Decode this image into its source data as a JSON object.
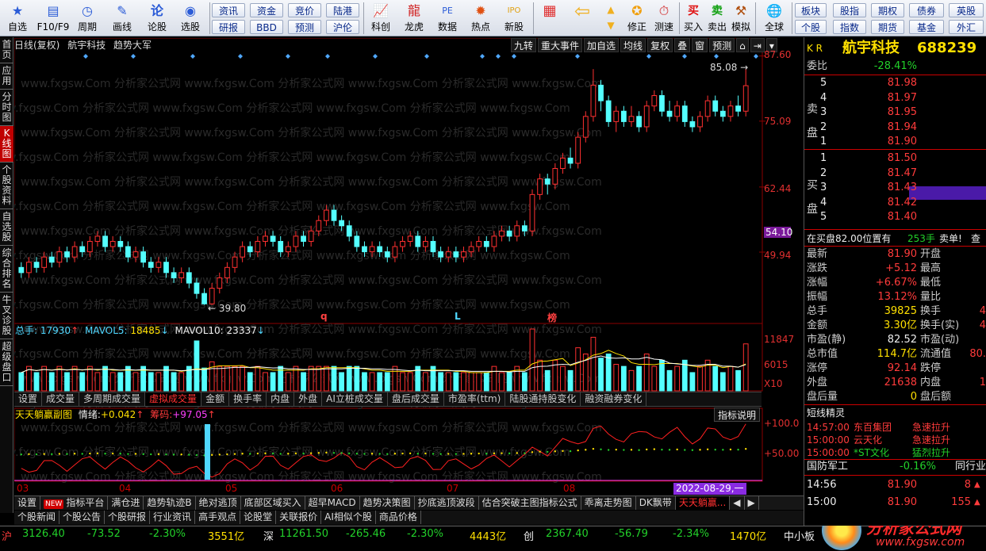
{
  "toolbar": {
    "big_buttons": [
      {
        "label": "自选",
        "icon": "star-icon"
      },
      {
        "label": "F10/F9",
        "icon": "document-icon"
      },
      {
        "label": "周期",
        "icon": "cycle-icon"
      },
      {
        "label": "画线",
        "icon": "pencil-icon"
      },
      {
        "label": "论股",
        "icon": "forum-icon"
      },
      {
        "label": "选股",
        "icon": "stock-picker-icon"
      }
    ],
    "small_buttons_top": [
      "资讯",
      "资金",
      "竞价",
      "陆港"
    ],
    "small_buttons_bottom": [
      "研报",
      "BBD",
      "预测",
      "沪伦"
    ],
    "mid_buttons": [
      {
        "label": "科创",
        "icon": "chart-icon"
      },
      {
        "label": "龙虎",
        "icon": "dragon-icon"
      },
      {
        "label": "数据",
        "icon": "data-icon"
      },
      {
        "label": "热点",
        "icon": "hot-icon"
      },
      {
        "label": "新股",
        "icon": "ipo-icon"
      }
    ],
    "right_buttons": [
      {
        "label": "",
        "icon": "blocks-icon"
      },
      {
        "label": "",
        "icon": "back-arrow-icon"
      },
      {
        "label": "修正",
        "icon": "fix-icon"
      },
      {
        "label": "测速",
        "icon": "speed-icon"
      },
      {
        "label": "买入",
        "icon": "buy-icon"
      },
      {
        "label": "卖出",
        "icon": "sell-icon"
      },
      {
        "label": "模拟",
        "icon": "hammer-icon"
      },
      {
        "label": "全球",
        "icon": "globe-icon"
      }
    ],
    "far_right_top": [
      "板块",
      "股指",
      "期权",
      "债券",
      "英股"
    ],
    "far_right_bottom": [
      "个股",
      "指数",
      "期货",
      "基金",
      "外汇"
    ]
  },
  "left_tabs": [
    "首页",
    "应用",
    "分时图",
    "K线图",
    "个股资料",
    "自选股",
    "综合排名",
    "牛叉诊股",
    "超级盘口"
  ],
  "chart": {
    "period_label": "日线(复权)",
    "stock_name": "航宇科技",
    "indicator_name": "趋势大军",
    "buttons": [
      "九转",
      "重大事件",
      "加自选",
      "均线",
      "复权",
      "叠",
      "窗",
      "预测"
    ],
    "price_ticks": [
      "87.60",
      "75.09",
      "62.44",
      "49.94"
    ],
    "current_price_tag": "54.10",
    "high_marker": "85.08",
    "low_marker": "39.80",
    "event_markers": [
      "q",
      "L",
      "榜"
    ],
    "colors": {
      "up": "#ff3030",
      "down": "#54ffff",
      "axis": "#8b0000"
    }
  },
  "volume": {
    "label": "总手",
    "value": "17930",
    "mavol5_label": "MAVOL5:",
    "mavol5": "18485",
    "mavol10_label": "MAVOL10:",
    "mavol10": "23337",
    "ticks": [
      "11847",
      "6015",
      "X10"
    ]
  },
  "indicator_tabs": [
    "设置",
    "成交量",
    "多周期成交量",
    "虚拟成交量",
    "金额",
    "换手率",
    "内盘",
    "外盘",
    "AI立桩成交量",
    "盘后成交量",
    "市盈率(ttm)",
    "陆股通持股变化",
    "融资融券变化"
  ],
  "sub_chart": {
    "title": "天天躺赢副图",
    "mood_label": "情绪:",
    "mood_value": "+0.042",
    "chip_label": "筹码:",
    "chip_value": "+97.05",
    "help_button": "指标说明",
    "ticks": [
      "+100.0",
      "+50.00"
    ]
  },
  "date_axis": {
    "labels": [
      "03",
      "04",
      "05",
      "06",
      "07",
      "08"
    ],
    "highlight": "2022-08-29,一"
  },
  "bottom_tabs": [
    "设置",
    "指标平台",
    "满仓进",
    "趋势轨迹B",
    "绝对逃顶",
    "底部区域买入",
    "超早MACD",
    "趋势决策图",
    "抄底逃顶波段",
    "估合突破主图指标公式",
    "乖离走势图",
    "DK飘带",
    "天天躺赢..."
  ],
  "bottom_new_badge": "NEW",
  "info_tabs": [
    "个股新闻",
    "个股公告",
    "个股研报",
    "行业资讯",
    "高手观点",
    "论股堂",
    "关联报价",
    "AI相似个股",
    "商品价格"
  ],
  "statusbar": {
    "sh_label": "沪",
    "sh_index": "3126.40",
    "sh_change": "-73.52",
    "sh_pct": "-2.30%",
    "sh_amount": "3551亿",
    "sz_label": "深",
    "sz_index": "11261.50",
    "sz_change": "-265.46",
    "sz_pct": "-2.30%",
    "sz_amount": "4443亿",
    "cy_label": "创",
    "cy_index": "2367.40",
    "cy_change": "-56.79",
    "cy_pct": "-2.34%",
    "cy_amount": "1470亿",
    "small_label": "中小板",
    "brand": "分析家公式网",
    "brand_url": "www.fxgsw.com"
  },
  "quote": {
    "kr": "K R",
    "name": "航宇科技",
    "code": "688239",
    "weibi_label": "委比",
    "weibi": "-28.41%",
    "sell_label": "卖盘",
    "buy_label": "买盘",
    "sells": [
      {
        "level": "5",
        "price": "81.98"
      },
      {
        "level": "4",
        "price": "81.97"
      },
      {
        "level": "3",
        "price": "81.95"
      },
      {
        "level": "2",
        "price": "81.94"
      },
      {
        "level": "1",
        "price": "81.90"
      }
    ],
    "buys": [
      {
        "level": "1",
        "price": "81.50"
      },
      {
        "level": "2",
        "price": "81.47"
      },
      {
        "level": "3",
        "price": "81.43"
      },
      {
        "level": "4",
        "price": "81.42"
      },
      {
        "level": "5",
        "price": "81.40"
      }
    ],
    "ticker_line": {
      "prefix": "在买盘82.00位置有",
      "vol": "253手",
      "tail": "卖单!",
      "extra": "查"
    },
    "stats_left": [
      {
        "label": "最新",
        "value": "81.90",
        "color": "red"
      },
      {
        "label": "涨跌",
        "value": "+5.12",
        "color": "red"
      },
      {
        "label": "涨幅",
        "value": "+6.67%",
        "color": "red"
      },
      {
        "label": "振幅",
        "value": "13.12%",
        "color": "red"
      },
      {
        "label": "总手",
        "value": "39825",
        "color": "yellow"
      },
      {
        "label": "金额",
        "value": "3.30亿",
        "color": "yellow"
      },
      {
        "label": "市盈(静)",
        "value": "82.52",
        "color": "white"
      },
      {
        "label": "总市值",
        "value": "114.7亿",
        "color": "yellow"
      },
      {
        "label": "涨停",
        "value": "92.14",
        "color": "red"
      },
      {
        "label": "外盘",
        "value": "21638",
        "color": "red"
      },
      {
        "label": "盘后量",
        "value": "0",
        "color": "yellow"
      }
    ],
    "stats_right": [
      {
        "label": "开盘",
        "value": ""
      },
      {
        "label": "最高",
        "value": ""
      },
      {
        "label": "最低",
        "value": ""
      },
      {
        "label": "量比",
        "value": ""
      },
      {
        "label": "换手",
        "value": "4"
      },
      {
        "label": "换手(实)",
        "value": "4"
      },
      {
        "label": "市盈(动)",
        "value": ""
      },
      {
        "label": "流通值",
        "value": "80."
      },
      {
        "label": "跌停",
        "value": ""
      },
      {
        "label": "内盘",
        "value": "1"
      },
      {
        "label": "盘后额",
        "value": ""
      }
    ],
    "short_line_title": "短线精灵",
    "short_line": [
      {
        "time": "14:57:00",
        "name": "东百集团",
        "event": "急速拉升"
      },
      {
        "time": "15:00:00",
        "name": "云天化",
        "event": "急速拉升"
      },
      {
        "time": "15:00:00",
        "name": "*ST文化",
        "event": "猛烈拉升"
      }
    ],
    "sector": {
      "name": "国防军工",
      "pct": "-0.16%",
      "peer": "同行业"
    },
    "ticks": [
      {
        "time": "14:56",
        "price": "81.90",
        "vol": "8"
      },
      {
        "time": "15:00",
        "price": "81.90",
        "vol": "155"
      }
    ]
  },
  "chart_data": {
    "type": "candlestick",
    "ylim": [
      37,
      88
    ],
    "candles": [
      [
        47,
        46,
        48,
        45
      ],
      [
        46,
        48,
        49,
        45
      ],
      [
        48,
        47,
        49,
        46
      ],
      [
        47,
        49,
        50,
        46
      ],
      [
        49,
        48,
        50,
        47
      ],
      [
        48,
        50,
        51,
        47
      ],
      [
        50,
        49,
        51,
        48
      ],
      [
        49,
        51,
        52,
        48
      ],
      [
        51,
        50,
        52,
        49
      ],
      [
        50,
        52,
        53,
        49
      ],
      [
        52,
        53,
        54,
        51
      ],
      [
        53,
        51,
        54,
        50
      ],
      [
        51,
        52,
        53,
        50
      ],
      [
        52,
        51,
        53,
        50
      ],
      [
        51,
        49,
        52,
        48
      ],
      [
        49,
        50,
        51,
        48
      ],
      [
        50,
        48,
        51,
        47
      ],
      [
        48,
        47,
        49,
        46
      ],
      [
        47,
        48,
        49,
        46
      ],
      [
        48,
        46,
        49,
        45
      ],
      [
        46,
        45,
        47,
        44
      ],
      [
        45,
        46,
        47,
        44
      ],
      [
        46,
        44,
        47,
        43
      ],
      [
        44,
        42,
        45,
        41
      ],
      [
        42,
        40,
        43,
        39.8
      ],
      [
        40,
        43,
        44,
        39.8
      ],
      [
        43,
        45,
        46,
        42
      ],
      [
        45,
        47,
        48,
        44
      ],
      [
        47,
        49,
        50,
        46
      ],
      [
        49,
        51,
        52,
        48
      ],
      [
        51,
        50,
        52,
        49
      ],
      [
        50,
        52,
        53,
        49
      ],
      [
        52,
        53,
        54,
        51
      ],
      [
        53,
        52,
        54,
        51
      ],
      [
        52,
        50,
        53,
        49
      ],
      [
        50,
        51,
        52,
        49
      ],
      [
        51,
        53,
        54,
        50
      ],
      [
        53,
        52,
        54,
        51
      ],
      [
        52,
        54,
        55,
        51
      ],
      [
        54,
        56,
        57,
        53
      ],
      [
        56,
        58,
        59,
        55
      ],
      [
        58,
        56,
        59,
        55
      ],
      [
        56,
        55,
        57,
        54
      ],
      [
        55,
        53,
        56,
        52
      ],
      [
        53,
        51,
        54,
        50
      ],
      [
        51,
        50,
        52,
        49
      ],
      [
        50,
        51,
        52,
        49
      ],
      [
        51,
        50,
        52,
        49
      ],
      [
        50,
        49,
        51,
        48
      ],
      [
        49,
        51,
        52,
        48
      ],
      [
        51,
        52,
        53,
        50
      ],
      [
        52,
        53,
        54,
        51
      ],
      [
        53,
        51,
        54,
        50
      ],
      [
        51,
        52,
        53,
        50
      ],
      [
        52,
        50,
        53,
        49
      ],
      [
        50,
        49,
        51,
        48
      ],
      [
        49,
        50,
        51,
        48
      ],
      [
        50,
        49,
        51,
        48
      ],
      [
        49,
        50,
        51,
        48
      ],
      [
        50,
        51,
        52,
        49
      ],
      [
        51,
        52,
        53,
        50
      ],
      [
        52,
        51,
        53,
        50
      ],
      [
        51,
        53,
        54,
        50
      ],
      [
        53,
        54,
        55,
        52
      ],
      [
        54,
        53,
        55,
        52
      ],
      [
        53,
        55,
        56,
        52
      ],
      [
        55,
        54,
        56,
        53
      ],
      [
        54,
        61,
        62,
        53
      ],
      [
        61,
        64,
        65,
        60
      ],
      [
        64,
        63,
        65,
        61
      ],
      [
        63,
        66,
        67,
        62
      ],
      [
        66,
        68,
        69,
        65
      ],
      [
        68,
        67,
        70,
        66
      ],
      [
        67,
        72,
        73,
        66
      ],
      [
        72,
        76,
        77,
        71
      ],
      [
        76,
        82,
        85.08,
        75
      ],
      [
        82,
        79,
        83,
        77
      ],
      [
        79,
        75,
        80,
        74
      ],
      [
        75,
        77,
        78,
        73
      ],
      [
        77,
        75,
        78,
        74
      ],
      [
        75,
        76,
        78,
        74
      ],
      [
        76,
        74,
        77,
        73
      ],
      [
        74,
        78,
        79,
        73
      ],
      [
        78,
        80,
        81,
        77
      ],
      [
        80,
        77,
        81,
        76
      ],
      [
        77,
        76,
        79,
        75
      ],
      [
        76,
        78,
        79,
        75
      ],
      [
        78,
        75,
        79,
        74
      ],
      [
        75,
        74,
        76,
        73
      ],
      [
        74,
        76,
        77,
        73
      ],
      [
        76,
        79,
        80,
        75
      ],
      [
        79,
        77,
        80,
        76
      ],
      [
        77,
        76,
        78,
        75
      ],
      [
        76,
        78,
        79,
        75
      ],
      [
        78,
        77,
        80,
        76
      ],
      [
        77,
        81.9,
        85.08,
        76
      ]
    ]
  }
}
